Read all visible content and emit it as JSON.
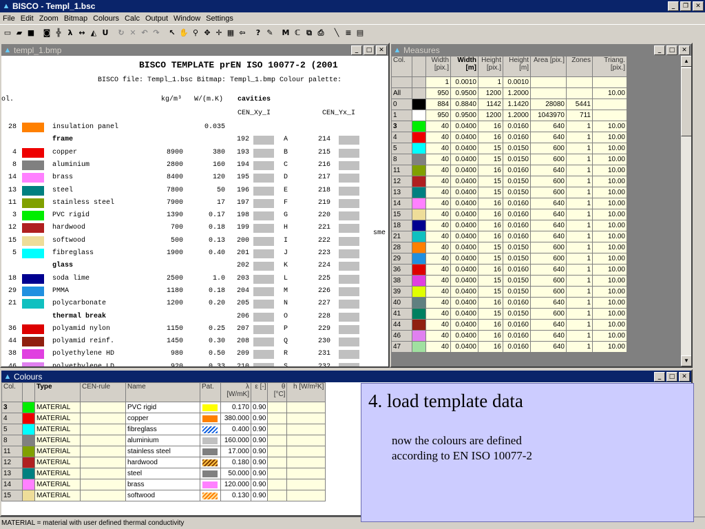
{
  "app": {
    "title": "BISCO - Templ_1.bsc",
    "menu": [
      "File",
      "Edit",
      "Zoom",
      "Bitmap",
      "Colours",
      "Calc",
      "Output",
      "Window",
      "Settings"
    ]
  },
  "template_window": {
    "title": "templ_1.bmp",
    "heading": "BISCO TEMPLATE prEN ISO 10077-2 (2001",
    "subheading": "BISCO file: Templ_1.bsc   Bitmap: Templ_1.bmp   Colour palette:",
    "col_header": "ol.",
    "header_density": "kg/m³",
    "header_conductivity": "W/(m.K)",
    "header_cavities": "cavities",
    "header_cen_xy": "CEN_Xy_I",
    "header_cen_yx": "CEN_Yx_I",
    "edge_text": "sme",
    "rows": [
      {
        "no": "28",
        "color": "#ff8000",
        "name": "insulation panel",
        "density": "",
        "lambda": "0.035",
        "cav": "",
        "letter": "",
        "cav2": ""
      },
      {
        "no": "",
        "color": "",
        "name": "frame",
        "density": "",
        "lambda": "",
        "cav": "192",
        "letter": "A",
        "cav2": "214",
        "bold": true
      },
      {
        "no": "4",
        "color": "#ee0000",
        "name": "copper",
        "density": "8900",
        "lambda": "380",
        "cav": "193",
        "letter": "B",
        "cav2": "215"
      },
      {
        "no": "8",
        "color": "#808080",
        "name": "aluminium",
        "density": "2800",
        "lambda": "160",
        "cav": "194",
        "letter": "C",
        "cav2": "216"
      },
      {
        "no": "14",
        "color": "#ff80ff",
        "name": "brass",
        "density": "8400",
        "lambda": "120",
        "cav": "195",
        "letter": "D",
        "cav2": "217"
      },
      {
        "no": "13",
        "color": "#008080",
        "name": "steel",
        "density": "7800",
        "lambda": "50",
        "cav": "196",
        "letter": "E",
        "cav2": "218"
      },
      {
        "no": "11",
        "color": "#80a000",
        "name": "stainless steel",
        "density": "7900",
        "lambda": "17",
        "cav": "197",
        "letter": "F",
        "cav2": "219"
      },
      {
        "no": "3",
        "color": "#00ee00",
        "name": "PVC rigid",
        "density": "1390",
        "lambda": "0.17",
        "cav": "198",
        "letter": "G",
        "cav2": "220"
      },
      {
        "no": "12",
        "color": "#b02020",
        "name": "hardwood",
        "density": "700",
        "lambda": "0.18",
        "cav": "199",
        "letter": "H",
        "cav2": "221"
      },
      {
        "no": "15",
        "color": "#eedd99",
        "name": "softwood",
        "density": "500",
        "lambda": "0.13",
        "cav": "200",
        "letter": "I",
        "cav2": "222"
      },
      {
        "no": "5",
        "color": "#00ffff",
        "name": "fibreglass",
        "density": "1900",
        "lambda": "0.40",
        "cav": "201",
        "letter": "J",
        "cav2": "223"
      },
      {
        "no": "",
        "color": "",
        "name": "glass",
        "density": "",
        "lambda": "",
        "cav": "202",
        "letter": "K",
        "cav2": "224",
        "bold": true
      },
      {
        "no": "18",
        "color": "#000090",
        "name": "soda lime",
        "density": "2500",
        "lambda": "1.0",
        "cav": "203",
        "letter": "L",
        "cav2": "225"
      },
      {
        "no": "29",
        "color": "#2090e0",
        "name": "PMMA",
        "density": "1180",
        "lambda": "0.18",
        "cav": "204",
        "letter": "M",
        "cav2": "226"
      },
      {
        "no": "21",
        "color": "#10c0c0",
        "name": "polycarbonate",
        "density": "1200",
        "lambda": "0.20",
        "cav": "205",
        "letter": "N",
        "cav2": "227"
      },
      {
        "no": "",
        "color": "",
        "name": "thermal break",
        "density": "",
        "lambda": "",
        "cav": "206",
        "letter": "O",
        "cav2": "228",
        "bold": true
      },
      {
        "no": "36",
        "color": "#dd0000",
        "name": "polyamid nylon",
        "density": "1150",
        "lambda": "0.25",
        "cav": "207",
        "letter": "P",
        "cav2": "229"
      },
      {
        "no": "44",
        "color": "#902010",
        "name": "polyamid reinf.",
        "density": "1450",
        "lambda": "0.30",
        "cav": "208",
        "letter": "Q",
        "cav2": "230"
      },
      {
        "no": "38",
        "color": "#e040e0",
        "name": "polyethylene HD",
        "density": "980",
        "lambda": "0.50",
        "cav": "209",
        "letter": "R",
        "cav2": "231"
      },
      {
        "no": "46",
        "color": "#e080f0",
        "name": "polyethylene LD",
        "density": "920",
        "lambda": "0.33",
        "cav": "210",
        "letter": "S",
        "cav2": "232"
      }
    ]
  },
  "measures_window": {
    "title": "Measures",
    "headers": [
      "Col.",
      "",
      "Width [pix.]",
      "Width [m]",
      "Height [pix.]",
      "Height [m]",
      "Area [pix.]",
      "Zones",
      "Triang. [pix.]"
    ],
    "rows": [
      {
        "col": "",
        "color": "",
        "w": "1",
        "wm": "0.0010",
        "h": "1",
        "hm": "0.0010",
        "a": "",
        "z": "",
        "t": ""
      },
      {
        "col": "All",
        "color": "",
        "w": "950",
        "wm": "0.9500",
        "h": "1200",
        "hm": "1.2000",
        "a": "",
        "z": "",
        "t": "10.00"
      },
      {
        "col": "0",
        "color": "#000000",
        "w": "884",
        "wm": "0.8840",
        "h": "1142",
        "hm": "1.1420",
        "a": "28080",
        "z": "5441",
        "t": ""
      },
      {
        "col": "1",
        "color": "#ffffff",
        "w": "950",
        "wm": "0.9500",
        "h": "1200",
        "hm": "1.2000",
        "a": "1043970",
        "z": "711",
        "t": ""
      },
      {
        "col": "3",
        "color": "#00ee00",
        "w": "40",
        "wm": "0.0400",
        "h": "16",
        "hm": "0.0160",
        "a": "640",
        "z": "1",
        "t": "10.00"
      },
      {
        "col": "4",
        "color": "#ee0000",
        "w": "40",
        "wm": "0.0400",
        "h": "16",
        "hm": "0.0160",
        "a": "640",
        "z": "1",
        "t": "10.00"
      },
      {
        "col": "5",
        "color": "#00ffff",
        "w": "40",
        "wm": "0.0400",
        "h": "15",
        "hm": "0.0150",
        "a": "600",
        "z": "1",
        "t": "10.00"
      },
      {
        "col": "8",
        "color": "#808080",
        "w": "40",
        "wm": "0.0400",
        "h": "15",
        "hm": "0.0150",
        "a": "600",
        "z": "1",
        "t": "10.00"
      },
      {
        "col": "11",
        "color": "#80a000",
        "w": "40",
        "wm": "0.0400",
        "h": "16",
        "hm": "0.0160",
        "a": "640",
        "z": "1",
        "t": "10.00"
      },
      {
        "col": "12",
        "color": "#b02020",
        "w": "40",
        "wm": "0.0400",
        "h": "15",
        "hm": "0.0150",
        "a": "600",
        "z": "1",
        "t": "10.00"
      },
      {
        "col": "13",
        "color": "#008080",
        "w": "40",
        "wm": "0.0400",
        "h": "15",
        "hm": "0.0150",
        "a": "600",
        "z": "1",
        "t": "10.00"
      },
      {
        "col": "14",
        "color": "#ff80ff",
        "w": "40",
        "wm": "0.0400",
        "h": "16",
        "hm": "0.0160",
        "a": "640",
        "z": "1",
        "t": "10.00"
      },
      {
        "col": "15",
        "color": "#eedd99",
        "w": "40",
        "wm": "0.0400",
        "h": "16",
        "hm": "0.0160",
        "a": "640",
        "z": "1",
        "t": "10.00"
      },
      {
        "col": "18",
        "color": "#000090",
        "w": "40",
        "wm": "0.0400",
        "h": "16",
        "hm": "0.0160",
        "a": "640",
        "z": "1",
        "t": "10.00"
      },
      {
        "col": "21",
        "color": "#10c0c0",
        "w": "40",
        "wm": "0.0400",
        "h": "16",
        "hm": "0.0160",
        "a": "640",
        "z": "1",
        "t": "10.00"
      },
      {
        "col": "28",
        "color": "#ff8000",
        "w": "40",
        "wm": "0.0400",
        "h": "15",
        "hm": "0.0150",
        "a": "600",
        "z": "1",
        "t": "10.00"
      },
      {
        "col": "29",
        "color": "#2090e0",
        "w": "40",
        "wm": "0.0400",
        "h": "15",
        "hm": "0.0150",
        "a": "600",
        "z": "1",
        "t": "10.00"
      },
      {
        "col": "36",
        "color": "#dd0000",
        "w": "40",
        "wm": "0.0400",
        "h": "16",
        "hm": "0.0160",
        "a": "640",
        "z": "1",
        "t": "10.00"
      },
      {
        "col": "38",
        "color": "#e040e0",
        "w": "40",
        "wm": "0.0400",
        "h": "15",
        "hm": "0.0150",
        "a": "600",
        "z": "1",
        "t": "10.00"
      },
      {
        "col": "39",
        "color": "#e0ff00",
        "w": "40",
        "wm": "0.0400",
        "h": "15",
        "hm": "0.0150",
        "a": "600",
        "z": "1",
        "t": "10.00"
      },
      {
        "col": "40",
        "color": "#608080",
        "w": "40",
        "wm": "0.0400",
        "h": "16",
        "hm": "0.0160",
        "a": "640",
        "z": "1",
        "t": "10.00"
      },
      {
        "col": "41",
        "color": "#008060",
        "w": "40",
        "wm": "0.0400",
        "h": "15",
        "hm": "0.0150",
        "a": "600",
        "z": "1",
        "t": "10.00"
      },
      {
        "col": "44",
        "color": "#902010",
        "w": "40",
        "wm": "0.0400",
        "h": "16",
        "hm": "0.0160",
        "a": "640",
        "z": "1",
        "t": "10.00"
      },
      {
        "col": "46",
        "color": "#e080f0",
        "w": "40",
        "wm": "0.0400",
        "h": "16",
        "hm": "0.0160",
        "a": "640",
        "z": "1",
        "t": "10.00"
      },
      {
        "col": "47",
        "color": "#a0e0a0",
        "w": "40",
        "wm": "0.0400",
        "h": "16",
        "hm": "0.0160",
        "a": "640",
        "z": "1",
        "t": "10.00"
      }
    ]
  },
  "colours_window": {
    "title": "Colours",
    "headers": [
      "Col.",
      "",
      "Type",
      "CEN-rule",
      "Name",
      "Pat.",
      "λ [W/mK]",
      "ε [-]",
      "θ [°C]",
      "h [W/m²K]"
    ],
    "rows": [
      {
        "col": "3",
        "color": "#00ee00",
        "type": "MATERIAL",
        "name": "PVC rigid",
        "pat": "#ffff00",
        "lam": "0.170",
        "eps": "0.90"
      },
      {
        "col": "4",
        "color": "#ee0000",
        "type": "MATERIAL",
        "name": "copper",
        "pat": "#ff8000",
        "lam": "380.000",
        "eps": "0.90"
      },
      {
        "col": "5",
        "color": "#00ffff",
        "type": "MATERIAL",
        "name": "fibreglass",
        "pat": "hatch-blue",
        "lam": "0.400",
        "eps": "0.90"
      },
      {
        "col": "8",
        "color": "#808080",
        "type": "MATERIAL",
        "name": "aluminium",
        "pat": "#c0c0c0",
        "lam": "160.000",
        "eps": "0.90"
      },
      {
        "col": "11",
        "color": "#80a000",
        "type": "MATERIAL",
        "name": "stainless steel",
        "pat": "#808080",
        "lam": "17.000",
        "eps": "0.90"
      },
      {
        "col": "12",
        "color": "#b02020",
        "type": "MATERIAL",
        "name": "hardwood",
        "pat": "hatch-brown",
        "lam": "0.180",
        "eps": "0.90"
      },
      {
        "col": "13",
        "color": "#008080",
        "type": "MATERIAL",
        "name": "steel",
        "pat": "#808080",
        "lam": "50.000",
        "eps": "0.90"
      },
      {
        "col": "14",
        "color": "#ff80ff",
        "type": "MATERIAL",
        "name": "brass",
        "pat": "#ff80ff",
        "lam": "120.000",
        "eps": "0.90"
      },
      {
        "col": "15",
        "color": "#eedd99",
        "type": "MATERIAL",
        "name": "softwood",
        "pat": "hatch-orange",
        "lam": "0.130",
        "eps": "0.90"
      }
    ]
  },
  "status": "MATERIAL = material with user defined thermal conductivity",
  "overlay": {
    "heading": "4. load template data",
    "body": "now the colours are defined according to EN ISO 10077-2"
  }
}
